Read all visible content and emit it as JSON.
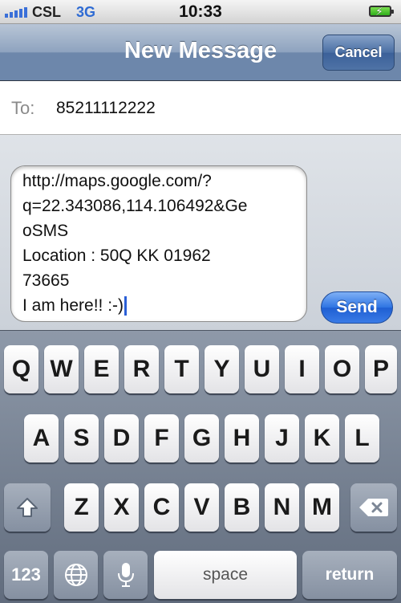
{
  "status_bar": {
    "carrier": "CSL",
    "network": "3G",
    "time": "10:33",
    "signal_icon": "signal-bars-icon",
    "battery_icon": "battery-charging-icon"
  },
  "nav": {
    "title": "New Message",
    "cancel_label": "Cancel"
  },
  "recipient": {
    "label": "To:",
    "value": "85211112222"
  },
  "message": {
    "lines": [
      "http://maps.google.com/?",
      "q=22.343086,114.106492&Ge",
      "oSMS",
      "Location : 50Q KK 01962",
      "73665",
      "I am here!! :-)"
    ],
    "send_label": "Send"
  },
  "keyboard": {
    "row1": [
      "Q",
      "W",
      "E",
      "R",
      "T",
      "Y",
      "U",
      "I",
      "O",
      "P"
    ],
    "row2": [
      "A",
      "S",
      "D",
      "F",
      "G",
      "H",
      "J",
      "K",
      "L"
    ],
    "row3": [
      "Z",
      "X",
      "C",
      "V",
      "B",
      "N",
      "M"
    ],
    "shift_icon": "shift-arrow-icon",
    "delete_icon": "backspace-icon",
    "numbers_label": "123",
    "globe_icon": "globe-icon",
    "mic_icon": "microphone-icon",
    "space_label": "space",
    "return_label": "return"
  },
  "colors": {
    "accent": "#2e74e3",
    "network_text": "#2f6bd3"
  }
}
